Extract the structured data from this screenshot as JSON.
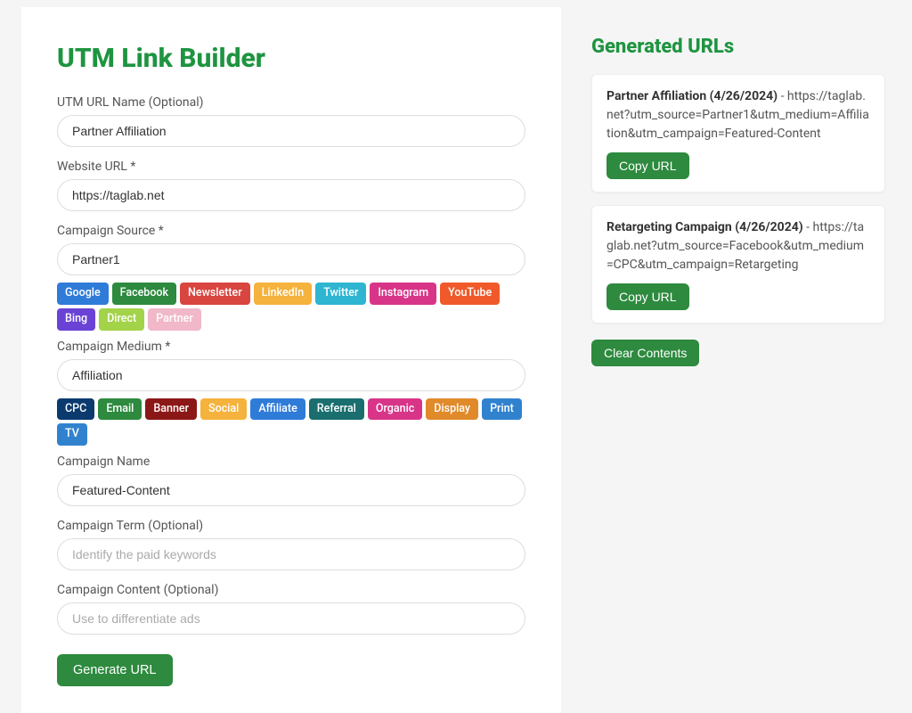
{
  "pageTitle": "UTM Link Builder",
  "generatedTitle": "Generated URLs",
  "labels": {
    "urlName": "UTM URL Name (Optional)",
    "websiteUrl": "Website URL *",
    "campaignSource": "Campaign Source *",
    "campaignMedium": "Campaign Medium *",
    "campaignName": "Campaign Name",
    "campaignTerm": "Campaign Term (Optional)",
    "campaignContent": "Campaign Content (Optional)"
  },
  "values": {
    "urlName": "Partner Affiliation",
    "websiteUrl": "https://taglab.net",
    "campaignSource": "Partner1",
    "campaignMedium": "Affiliation",
    "campaignName": "Featured-Content",
    "campaignTerm": "",
    "campaignContent": ""
  },
  "placeholders": {
    "campaignTerm": "Identify the paid keywords",
    "campaignContent": "Use to differentiate ads"
  },
  "sourcePills": [
    {
      "label": "Google",
      "color": "#2f7bd8"
    },
    {
      "label": "Facebook",
      "color": "#2d8a3e"
    },
    {
      "label": "Newsletter",
      "color": "#d9463f"
    },
    {
      "label": "LinkedIn",
      "color": "#f5b23c"
    },
    {
      "label": "Twitter",
      "color": "#2eb5d1"
    },
    {
      "label": "Instagram",
      "color": "#d83589"
    },
    {
      "label": "YouTube",
      "color": "#f05a2a"
    },
    {
      "label": "Bing",
      "color": "#6a43d6"
    },
    {
      "label": "Direct",
      "color": "#a3d349"
    },
    {
      "label": "Partner",
      "color": "#f0b8c9"
    }
  ],
  "mediumPills": [
    {
      "label": "CPC",
      "color": "#0a3a6e"
    },
    {
      "label": "Email",
      "color": "#2d8a3e"
    },
    {
      "label": "Banner",
      "color": "#8b1717"
    },
    {
      "label": "Social",
      "color": "#f5b23c"
    },
    {
      "label": "Affiliate",
      "color": "#2f7bd8"
    },
    {
      "label": "Referral",
      "color": "#1a6e6e"
    },
    {
      "label": "Organic",
      "color": "#d83589"
    },
    {
      "label": "Display",
      "color": "#e08a2a"
    },
    {
      "label": "Print",
      "color": "#3182ce"
    },
    {
      "label": "TV",
      "color": "#3182ce"
    }
  ],
  "buttons": {
    "generate": "Generate URL",
    "copy": "Copy URL",
    "clear": "Clear Contents"
  },
  "generatedUrls": [
    {
      "title": "Partner Affiliation (4/26/2024)",
      "url": "https://taglab.net?utm_source=Partner1&utm_medium=Affiliation&utm_campaign=Featured-Content"
    },
    {
      "title": "Retargeting Campaign (4/26/2024)",
      "url": "https://taglab.net?utm_source=Facebook&utm_medium=CPC&utm_campaign=Retargeting"
    }
  ]
}
